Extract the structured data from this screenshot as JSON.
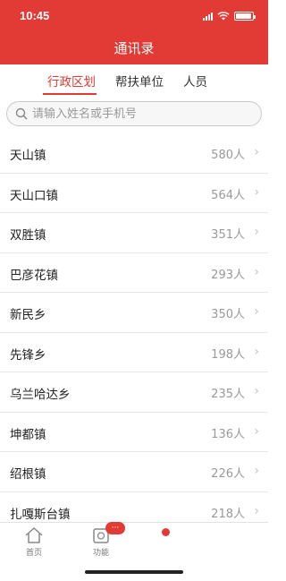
{
  "status_bar": {
    "time": "10:45"
  },
  "header": {
    "title": "通讯录"
  },
  "tabs": [
    {
      "label": "行政区划",
      "active": true
    },
    {
      "label": "帮扶单位",
      "active": false
    },
    {
      "label": "人员",
      "active": false
    }
  ],
  "search": {
    "placeholder": "请输入姓名或手机号"
  },
  "list": [
    {
      "name": "天山镇",
      "count": "580人"
    },
    {
      "name": "天山口镇",
      "count": "564人"
    },
    {
      "name": "双胜镇",
      "count": "351人"
    },
    {
      "name": "巴彦花镇",
      "count": "293人"
    },
    {
      "name": "新民乡",
      "count": "350人"
    },
    {
      "name": "先锋乡",
      "count": "198人"
    },
    {
      "name": "乌兰哈达乡",
      "count": "235人"
    },
    {
      "name": "坤都镇",
      "count": "136人"
    },
    {
      "name": "绍根镇",
      "count": "226人"
    },
    {
      "name": "扎嘎斯台镇",
      "count": "218人"
    }
  ],
  "tabbar": {
    "home_label": "首页",
    "function_label": "功能",
    "badge": "···"
  },
  "colors": {
    "accent": "#e23b36"
  }
}
